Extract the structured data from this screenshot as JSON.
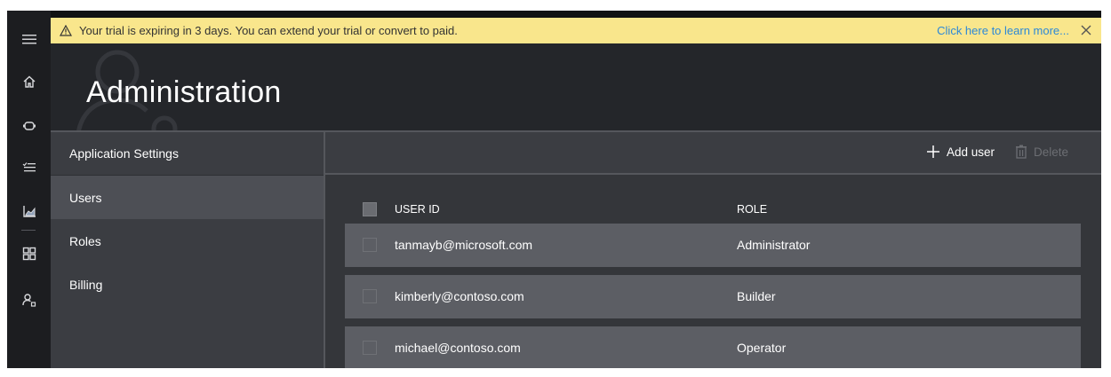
{
  "banner": {
    "message": "Your trial is expiring in 3 days. You can extend your trial or convert to paid.",
    "link": "Click here to learn more...",
    "color": "#f9e68c",
    "link_color": "#2b88d8"
  },
  "header": {
    "title": "Administration"
  },
  "rail": {
    "icons": [
      "hamburger-menu-icon",
      "home-icon",
      "devices-icon",
      "rules-icon",
      "analytics-icon",
      "dashboard-icon",
      "administration-icon"
    ]
  },
  "nav": {
    "heading": "Application Settings",
    "items": [
      {
        "label": "Users",
        "selected": true
      },
      {
        "label": "Roles",
        "selected": false
      },
      {
        "label": "Billing",
        "selected": false
      }
    ]
  },
  "toolbar": {
    "add_label": "Add user",
    "delete_label": "Delete"
  },
  "table": {
    "columns": [
      "USER ID",
      "ROLE"
    ],
    "rows": [
      {
        "user_id": "tanmayb@microsoft.com",
        "role": "Administrator"
      },
      {
        "user_id": "kimberly@contoso.com",
        "role": "Builder"
      },
      {
        "user_id": "michael@contoso.com",
        "role": "Operator"
      }
    ]
  }
}
